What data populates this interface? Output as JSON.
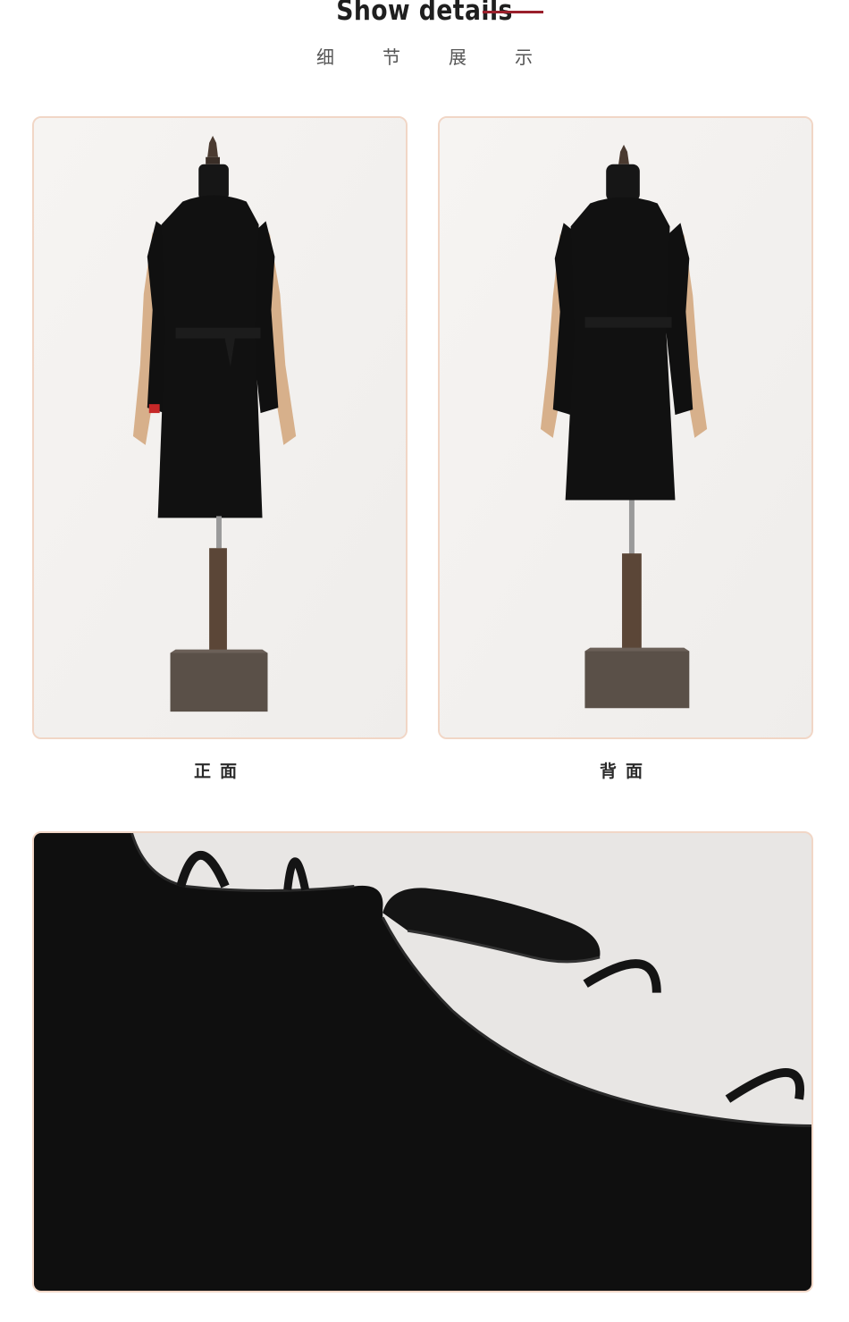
{
  "header": {
    "title": "Show details",
    "subtitle_chars": [
      "细",
      "节",
      "展",
      "示"
    ]
  },
  "gallery": {
    "front": {
      "caption": "正面",
      "image": "mannequin-front-black-dress-photo"
    },
    "back": {
      "caption": "背面",
      "image": "mannequin-back-black-dress-photo"
    },
    "detail": {
      "image": "neckline-cutout-strap-closeup-photo"
    }
  },
  "colors": {
    "accent": "#9a1f2b",
    "frame_border": "#f1d6c6",
    "garment": "#111111"
  }
}
